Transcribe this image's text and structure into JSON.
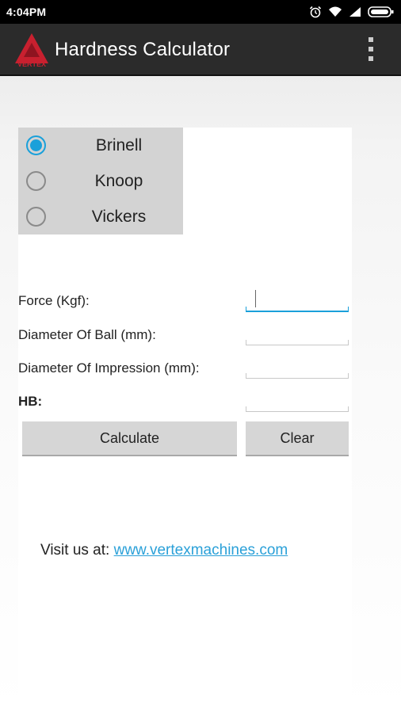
{
  "status_bar": {
    "time": "4:04PM",
    "icons": [
      "alarm-icon",
      "wifi-icon",
      "signal-icon",
      "battery-icon"
    ]
  },
  "action_bar": {
    "title": "Hardness Calculator",
    "logo_text": "VERTEX",
    "menu_icon": "overflow-menu-icon"
  },
  "hardness_types": [
    {
      "label": "Brinell",
      "checked": true
    },
    {
      "label": "Knoop",
      "checked": false
    },
    {
      "label": "Vickers",
      "checked": false
    }
  ],
  "form": {
    "force_label": "Force (Kgf):",
    "force_value": "",
    "ball_label": "Diameter Of Ball (mm):",
    "ball_value": "",
    "impression_label": "Diameter Of Impression (mm):",
    "impression_value": "",
    "result_label": "HB:",
    "result_value": ""
  },
  "buttons": {
    "calculate": "Calculate",
    "clear": "Clear"
  },
  "footer": {
    "visit_text": "Visit us at: ",
    "link_text": "www.vertexmachines.com"
  },
  "colors": {
    "accent": "#1aa0da",
    "action_bar": "#2b2b2b",
    "logo_red": "#c8202f",
    "link": "#2aa0d8"
  }
}
